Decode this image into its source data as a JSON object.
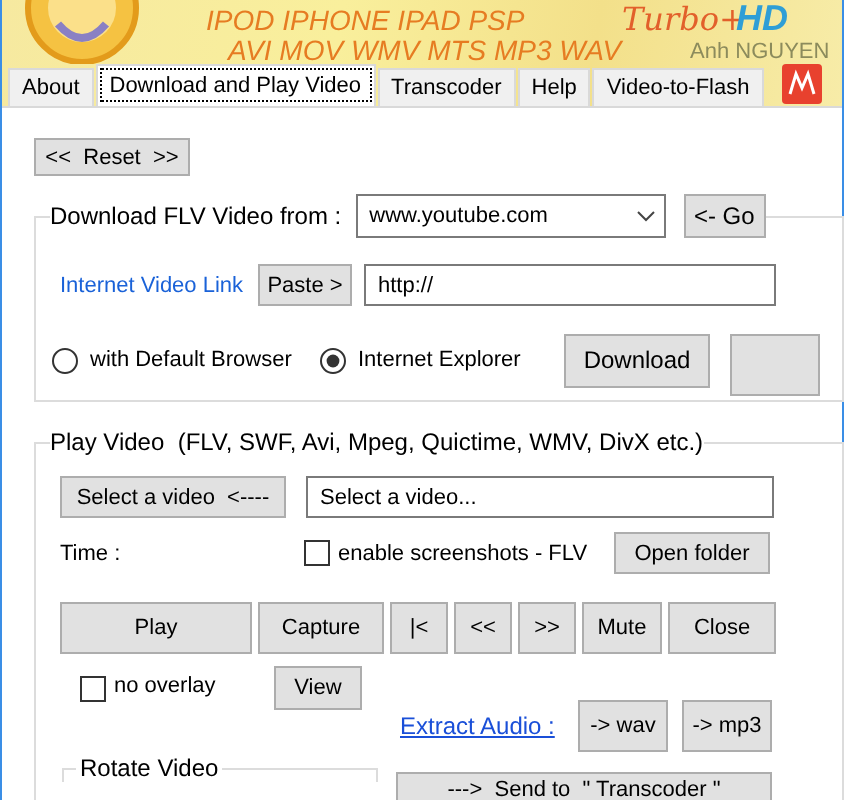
{
  "banner": {
    "lines": [
      "IPOD IPHONE IPAD PSP",
      "AVI MOV WMV MTS MP3 WAV"
    ],
    "turbo": "Turbo+",
    "hd": "HD",
    "author": "Anh NGUYEN"
  },
  "tabs": [
    {
      "label": "About",
      "selected": false
    },
    {
      "label": "Download and Play Video",
      "selected": true
    },
    {
      "label": "Transcoder",
      "selected": false
    },
    {
      "label": "Help",
      "selected": false
    },
    {
      "label": "Video-to-Flash",
      "selected": false
    }
  ],
  "reset_button": "<<  Reset  >>",
  "download": {
    "legend": "Download FLV Video from :",
    "site": "www.youtube.com",
    "go_button": "<- Go",
    "link_label": "Internet Video Link",
    "paste_button": "Paste >",
    "url": "http://",
    "browsers": [
      {
        "label": "with Default Browser",
        "selected": false
      },
      {
        "label": "Internet Explorer",
        "selected": true
      }
    ],
    "download_button": "Download"
  },
  "play": {
    "legend": "Play Video  (FLV, SWF, Avi, Mpeg, Quictime, WMV, DivX etc.)",
    "select_button": "Select a video  <----",
    "file_field": "Select a video...",
    "time_label": "Time :",
    "screenshots": {
      "label": "enable screenshots - FLV",
      "checked": false
    },
    "open_folder_button": "Open folder",
    "controls": [
      "Play",
      "Capture",
      "|<",
      "<<",
      ">>",
      "Mute",
      "Close"
    ],
    "no_overlay": {
      "label": "no overlay",
      "checked": false
    },
    "view_button": "View",
    "extract_audio_link": "Extract Audio :",
    "audio_buttons": [
      "-> wav",
      "-> mp3"
    ],
    "rotate": {
      "legend": "Rotate Video"
    },
    "send_button": "--->  Send to  \" Transcoder \""
  }
}
